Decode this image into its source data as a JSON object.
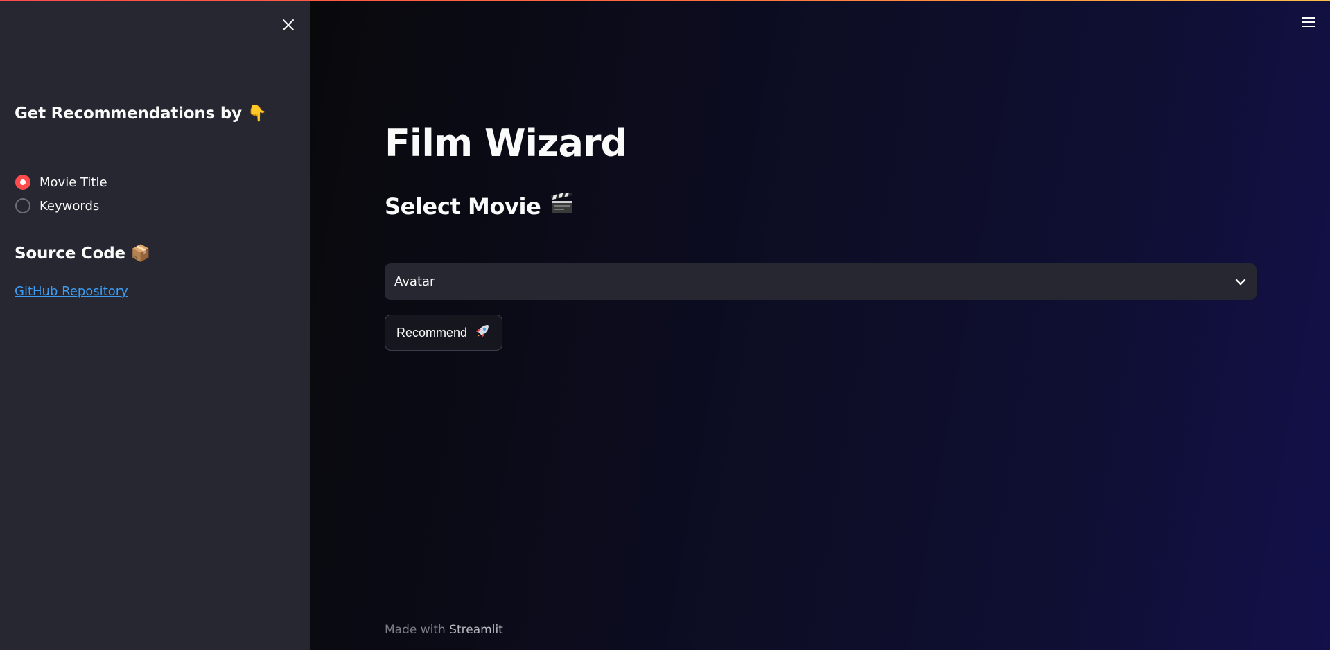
{
  "sidebar": {
    "close_icon": "close-icon",
    "recommend_heading": "Get Recommendations by 👇",
    "radio_options": [
      {
        "label": "Movie Title",
        "checked": true
      },
      {
        "label": "Keywords",
        "checked": false
      }
    ],
    "source_heading": "Source Code 📦",
    "github_link": "GitHub Repository"
  },
  "main": {
    "menu_icon": "hamburger-menu-icon",
    "title": "Film Wizard",
    "section_title": "Select Movie",
    "section_icon": "clapperboard-icon",
    "select": {
      "value": "Avatar",
      "icon": "chevron-down-icon"
    },
    "recommend_button": "Recommend",
    "recommend_icon": "rocket-icon",
    "footer": {
      "prefix": "Made with",
      "brand": "Streamlit"
    }
  },
  "colors": {
    "accent": "#ff4b4b",
    "sidebar_bg": "#262730",
    "link": "#3d9df3",
    "text": "#fafafa"
  }
}
